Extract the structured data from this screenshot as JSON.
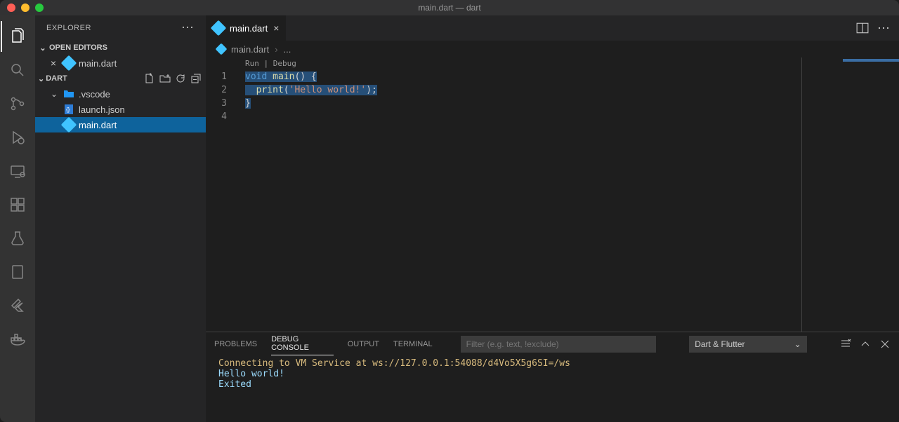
{
  "window": {
    "title": "main.dart — dart"
  },
  "sidebar": {
    "title": "EXPLORER",
    "openEditors": {
      "label": "OPEN EDITORS",
      "items": [
        {
          "name": "main.dart"
        }
      ]
    },
    "folder": {
      "name": "DART",
      "tree": [
        {
          "name": ".vscode",
          "kind": "folder"
        },
        {
          "name": "launch.json",
          "kind": "json"
        },
        {
          "name": "main.dart",
          "kind": "dart",
          "selected": true
        }
      ]
    }
  },
  "tabs": [
    {
      "name": "main.dart"
    }
  ],
  "breadcrumb": {
    "file": "main.dart",
    "more": "..."
  },
  "codelens": "Run | Debug",
  "code": {
    "lines": [
      "1",
      "2",
      "3",
      "4"
    ],
    "l1": {
      "k": "void",
      "f": " main",
      "p": "() {"
    },
    "l2": {
      "indent": "  ",
      "f": "print",
      "p1": "(",
      "s": "'Hello world!'",
      "p2": ");"
    },
    "l3": {
      "p": "}"
    }
  },
  "panel": {
    "tabs": {
      "problems": "Problems",
      "debug": "Debug Console",
      "output": "Output",
      "terminal": "Terminal"
    },
    "filterPlaceholder": "Filter (e.g. text, !exclude)",
    "select": "Dart & Flutter",
    "console": {
      "l1": "Connecting to VM Service at ws://127.0.0.1:54088/d4Vo5X5g6SI=/ws",
      "l2": "Hello world!",
      "l3": "Exited"
    }
  }
}
